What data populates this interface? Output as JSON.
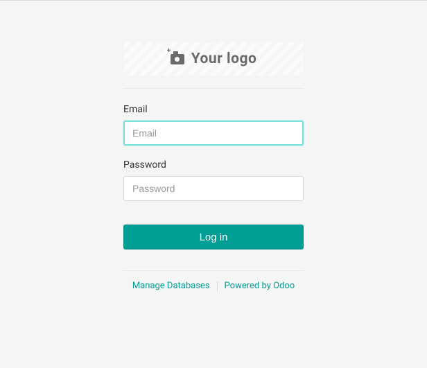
{
  "logo": {
    "placeholder_text": "Your logo",
    "icon": "camera-add-icon"
  },
  "form": {
    "email": {
      "label": "Email",
      "placeholder": "Email",
      "value": ""
    },
    "password": {
      "label": "Password",
      "placeholder": "Password",
      "value": ""
    },
    "submit_label": "Log in"
  },
  "footer": {
    "manage_db_label": "Manage Databases",
    "powered_by_label": "Powered by Odoo"
  },
  "colors": {
    "accent": "#009e94",
    "focus_ring": "#7fe0d8",
    "page_bg": "#f4f5f5"
  }
}
